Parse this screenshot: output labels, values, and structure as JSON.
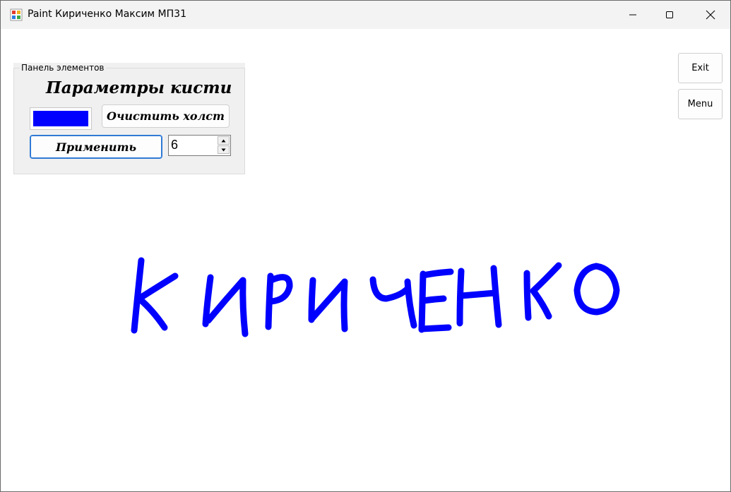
{
  "window": {
    "title": "Paint Кириченко Максим МП31",
    "icon": "paint-app-icon",
    "controls": {
      "minimize_icon": "minimize-icon",
      "maximize_icon": "maximize-icon",
      "close_icon": "close-icon"
    }
  },
  "panel": {
    "legend": "Панель элементов",
    "title": "Параметры кисти",
    "brush_color": "#0000ff",
    "clear_label": "Очистить холст",
    "apply_label": "Применить",
    "brush_size": "6"
  },
  "side_buttons": {
    "exit_label": "Exit",
    "menu_label": "Menu"
  },
  "canvas": {
    "stroke_color": "#0000ff",
    "handwritten_text": "КИРИЧЕНКО"
  }
}
